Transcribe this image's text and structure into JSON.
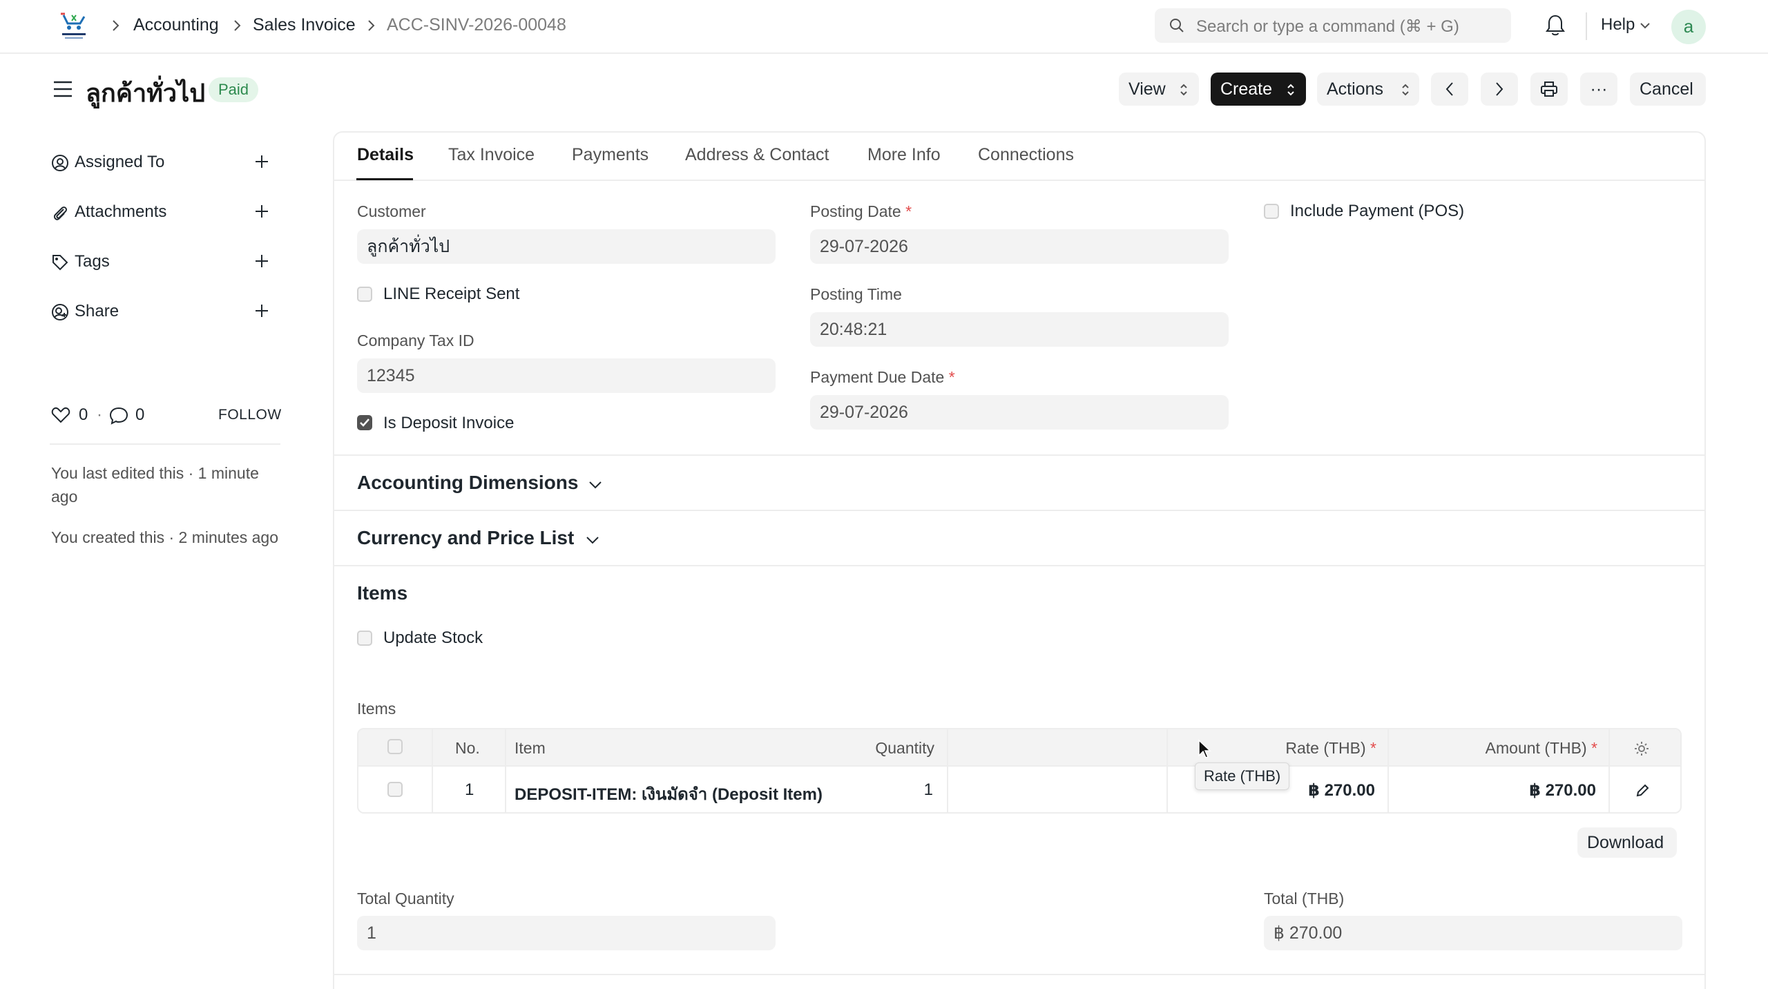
{
  "navbar": {
    "breadcrumbs": [
      "Accounting",
      "Sales Invoice",
      "ACC-SINV-2026-00048"
    ],
    "search_placeholder": "Search or type a command (⌘ + G)",
    "help_label": "Help",
    "avatar_initial": "a"
  },
  "header": {
    "title": "ลูกค้าทั่วไป",
    "status": "Paid",
    "view_label": "View",
    "create_label": "Create",
    "actions_label": "Actions",
    "more_label": "···",
    "cancel_label": "Cancel"
  },
  "sidebar": {
    "items": [
      {
        "label": "Assigned To",
        "icon": "user-circle-icon"
      },
      {
        "label": "Attachments",
        "icon": "paperclip-icon"
      },
      {
        "label": "Tags",
        "icon": "tag-icon"
      },
      {
        "label": "Share",
        "icon": "share-user-icon"
      }
    ],
    "likes": "0",
    "comments": "0",
    "follow_label": "FOLLOW",
    "last_edited": "You last edited this · 1 minute ago",
    "created": "You created this · 2 minutes ago"
  },
  "tabs": [
    "Details",
    "Tax Invoice",
    "Payments",
    "Address & Contact",
    "More Info",
    "Connections"
  ],
  "active_tab": "Details",
  "form": {
    "customer_label": "Customer",
    "customer_value": "ลูกค้าทั่วไป",
    "line_receipt_label": "LINE Receipt Sent",
    "line_receipt_checked": false,
    "company_tax_id_label": "Company Tax ID",
    "company_tax_id_value": "12345",
    "is_deposit_label": "Is Deposit Invoice",
    "is_deposit_checked": true,
    "posting_date_label": "Posting Date",
    "posting_date_value": "29-07-2026",
    "posting_time_label": "Posting Time",
    "posting_time_value": "20:48:21",
    "payment_due_label": "Payment Due Date",
    "payment_due_value": "29-07-2026",
    "include_payment_label": "Include Payment (POS)",
    "include_payment_checked": false,
    "required_mark": "*"
  },
  "sections": {
    "accounting_dimensions": "Accounting Dimensions",
    "currency_price_list": "Currency and Price List",
    "items": "Items"
  },
  "items_section": {
    "update_stock_label": "Update Stock",
    "update_stock_checked": false,
    "grid_label": "Items",
    "columns": [
      "No.",
      "Item",
      "Quantity",
      "Rate (THB)",
      "Amount (THB)"
    ],
    "rows": [
      {
        "no": "1",
        "item": "DEPOSIT-ITEM: เงินมัดจำ (Deposit Item)",
        "quantity": "1",
        "rate": "฿ 270.00",
        "amount": "฿ 270.00"
      }
    ],
    "tooltip": "Rate (THB)",
    "download_label": "Download",
    "total_qty_label": "Total Quantity",
    "total_qty_value": "1",
    "total_label": "Total (THB)",
    "total_value": "฿ 270.00"
  },
  "colors": {
    "accent_dark": "#171717",
    "paid_bg": "#e4f5e9",
    "paid_text": "#2d8a4e",
    "required": "#e24c4c"
  }
}
